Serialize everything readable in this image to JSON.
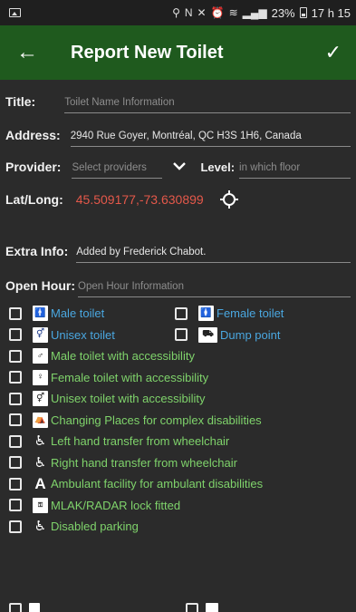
{
  "status_bar": {
    "left_icon": "image-icon",
    "icons": [
      "location-icon",
      "nfc-icon",
      "mute-icon",
      "alarm-icon",
      "wifi-icon",
      "signal-icon"
    ],
    "battery": "23%",
    "time": "17 h 15"
  },
  "app_bar": {
    "title": "Report New Toilet",
    "back_icon": "arrow-back-icon",
    "done_icon": "check-icon",
    "background": "#1f5a1e"
  },
  "form": {
    "title": {
      "label": "Title:",
      "placeholder": "Toilet Name Information"
    },
    "address": {
      "label": "Address:",
      "value": "2940 Rue Goyer, Montréal, QC H3S 1H6, Canada"
    },
    "provider": {
      "label": "Provider:",
      "placeholder": "Select providers"
    },
    "level": {
      "label": "Level:",
      "placeholder": "in which floor"
    },
    "latlong": {
      "label": "Lat/Long:",
      "value": "45.509177,-73.630899",
      "color": "#e4584a"
    },
    "extra_info": {
      "label": "Extra Info:",
      "value": "Added by Frederick Chabot."
    },
    "open_hour": {
      "label": "Open Hour:",
      "placeholder": "Open Hour Information"
    }
  },
  "options": [
    {
      "label": "Male toilet",
      "icon": "male-icon",
      "color": "#4aa7e0"
    },
    {
      "label": "Female toilet",
      "icon": "female-icon",
      "color": "#4aa7e0"
    },
    {
      "label": "Unisex toilet",
      "icon": "unisex-icon",
      "color": "#4aa7e0"
    },
    {
      "label": "Dump point",
      "icon": "dump-point-icon",
      "color": "#4aa7e0"
    },
    {
      "label": "Male toilet with accessibility",
      "icon": "male-accessible-icon",
      "color": "#7fd36b"
    },
    {
      "label": "Female toilet with accessibility",
      "icon": "female-accessible-icon",
      "color": "#7fd36b"
    },
    {
      "label": "Unisex toilet with accessibility",
      "icon": "unisex-accessible-icon",
      "color": "#7fd36b"
    },
    {
      "label": "Changing Places for complex disabilities",
      "icon": "changing-places-icon",
      "color": "#7fd36b"
    },
    {
      "label": "Left hand transfer from wheelchair",
      "icon": "left-hand-transfer-icon",
      "color": "#7fd36b"
    },
    {
      "label": "Right hand transfer from wheelchair",
      "icon": "right-hand-transfer-icon",
      "color": "#7fd36b"
    },
    {
      "label": "Ambulant facility for ambulant disabilities",
      "icon": "ambulant-icon",
      "color": "#7fd36b"
    },
    {
      "label": "MLAK/RADAR lock fitted",
      "icon": "mlak-key-icon",
      "color": "#7fd36b"
    },
    {
      "label": "Disabled parking",
      "icon": "disabled-parking-icon",
      "color": "#7fd36b"
    }
  ]
}
